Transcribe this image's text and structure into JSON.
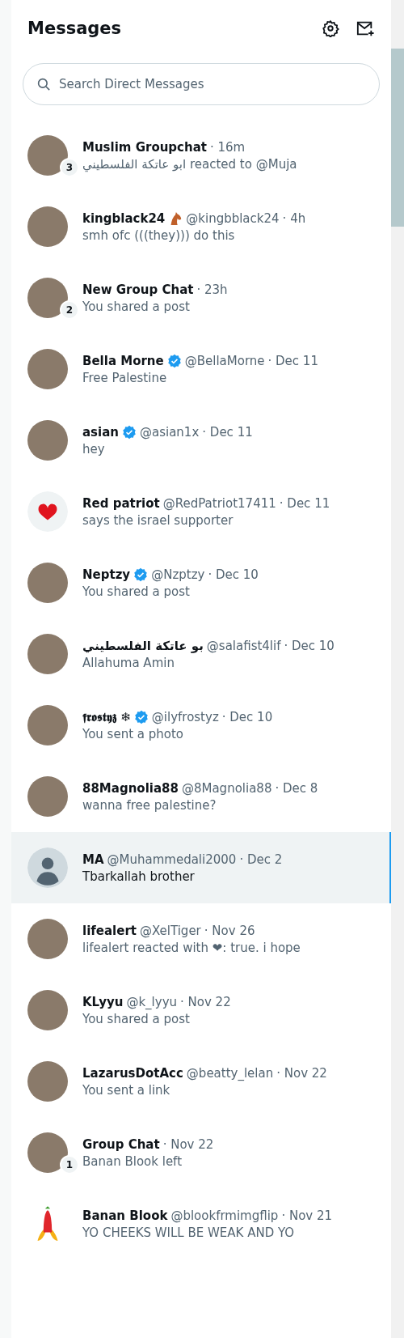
{
  "header": {
    "title": "Messages"
  },
  "search": {
    "placeholder": "Search Direct Messages"
  },
  "conversations": [
    {
      "name": "Muslim Groupchat",
      "time": "· 16m",
      "preview": "ابو عاتكة الفلسطيني reacted to @Muja",
      "badge": "3",
      "kind": "photo",
      "selected": false
    },
    {
      "name": "kingblack24",
      "name_icon": true,
      "handle": "@kingbblack24",
      "time": "· 4h",
      "preview": "smh ofc (((they))) do this",
      "kind": "photo",
      "selected": false
    },
    {
      "name": "New Group Chat",
      "time": "· 23h",
      "preview": "You shared a post",
      "badge": "2",
      "kind": "photo",
      "selected": false
    },
    {
      "name": "Bella Morne",
      "verified": true,
      "handle": "@BellaMorne",
      "time": "· Dec 11",
      "preview": "Free Palestine",
      "kind": "photo",
      "selected": false
    },
    {
      "name": "asian",
      "verified": true,
      "handle": "@asian1x",
      "time": "· Dec 11",
      "preview": "hey",
      "kind": "photo",
      "selected": false
    },
    {
      "name": "Red patriot",
      "handle": "@RedPatriot17411",
      "time": "· Dec 11",
      "preview": "says the israel supporter",
      "kind": "heart",
      "selected": false
    },
    {
      "name": "Neptzy",
      "verified": true,
      "handle": "@Nzptzy",
      "time": "· Dec 10",
      "preview": "You shared a post",
      "kind": "photo",
      "selected": false
    },
    {
      "name": "بو عاتكة الفلسطيني",
      "handle": "@salafist4lif",
      "time": "· Dec 10",
      "preview": "Allahuma Amin",
      "kind": "photo",
      "selected": false
    },
    {
      "name": "𝖋𝖗𝖔𝖘𝖙𝖞𝖟 ❄",
      "verified": true,
      "handle": "@ilyfrostyz",
      "time": "· Dec 10",
      "preview": "You sent a photo",
      "kind": "photo",
      "selected": false
    },
    {
      "name": "88Magnolia88",
      "handle": "@8Magnolia88",
      "time": "· Dec 8",
      "preview": "wanna free palestine?",
      "kind": "photo",
      "selected": false
    },
    {
      "name": "MA",
      "handle": "@Muhammedali2000",
      "time": "· Dec 2",
      "preview": "Tbarkallah brother",
      "kind": "default",
      "selected": true
    },
    {
      "name": "lifealert",
      "handle": "@XelTiger",
      "time": "· Nov 26",
      "preview": "lifealert reacted with ❤: true. i hope",
      "kind": "photo",
      "selected": false
    },
    {
      "name": "KLyyu",
      "handle": "@k_lyyu",
      "time": "· Nov 22",
      "preview": "You shared a post",
      "kind": "photo",
      "selected": false
    },
    {
      "name": "LazarusDotAcc",
      "handle": "@beatty_lelan",
      "time": "· Nov 22",
      "preview": "You sent a link",
      "kind": "photo",
      "selected": false
    },
    {
      "name": "Group Chat",
      "time": "· Nov 22",
      "preview": "Banan Blook left",
      "badge": "1",
      "kind": "photo",
      "selected": false
    },
    {
      "name": "Banan Blook",
      "handle": "@blookfrmimgflip",
      "time": "· Nov 21",
      "preview": "YO CHEEKS WILL BE WEAK AND YO",
      "kind": "banana",
      "selected": false
    }
  ]
}
